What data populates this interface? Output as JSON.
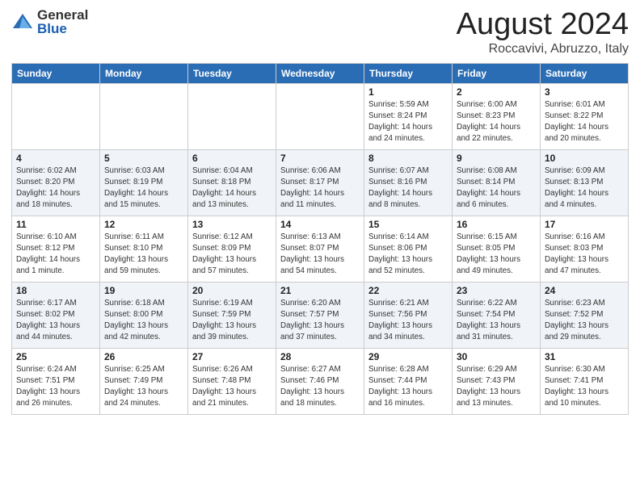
{
  "logo": {
    "general": "General",
    "blue": "Blue"
  },
  "title": "August 2024",
  "location": "Roccavivi, Abruzzo, Italy",
  "headers": [
    "Sunday",
    "Monday",
    "Tuesday",
    "Wednesday",
    "Thursday",
    "Friday",
    "Saturday"
  ],
  "weeks": [
    [
      {
        "day": "",
        "info": ""
      },
      {
        "day": "",
        "info": ""
      },
      {
        "day": "",
        "info": ""
      },
      {
        "day": "",
        "info": ""
      },
      {
        "day": "1",
        "info": "Sunrise: 5:59 AM\nSunset: 8:24 PM\nDaylight: 14 hours\nand 24 minutes."
      },
      {
        "day": "2",
        "info": "Sunrise: 6:00 AM\nSunset: 8:23 PM\nDaylight: 14 hours\nand 22 minutes."
      },
      {
        "day": "3",
        "info": "Sunrise: 6:01 AM\nSunset: 8:22 PM\nDaylight: 14 hours\nand 20 minutes."
      }
    ],
    [
      {
        "day": "4",
        "info": "Sunrise: 6:02 AM\nSunset: 8:20 PM\nDaylight: 14 hours\nand 18 minutes."
      },
      {
        "day": "5",
        "info": "Sunrise: 6:03 AM\nSunset: 8:19 PM\nDaylight: 14 hours\nand 15 minutes."
      },
      {
        "day": "6",
        "info": "Sunrise: 6:04 AM\nSunset: 8:18 PM\nDaylight: 14 hours\nand 13 minutes."
      },
      {
        "day": "7",
        "info": "Sunrise: 6:06 AM\nSunset: 8:17 PM\nDaylight: 14 hours\nand 11 minutes."
      },
      {
        "day": "8",
        "info": "Sunrise: 6:07 AM\nSunset: 8:16 PM\nDaylight: 14 hours\nand 8 minutes."
      },
      {
        "day": "9",
        "info": "Sunrise: 6:08 AM\nSunset: 8:14 PM\nDaylight: 14 hours\nand 6 minutes."
      },
      {
        "day": "10",
        "info": "Sunrise: 6:09 AM\nSunset: 8:13 PM\nDaylight: 14 hours\nand 4 minutes."
      }
    ],
    [
      {
        "day": "11",
        "info": "Sunrise: 6:10 AM\nSunset: 8:12 PM\nDaylight: 14 hours\nand 1 minute."
      },
      {
        "day": "12",
        "info": "Sunrise: 6:11 AM\nSunset: 8:10 PM\nDaylight: 13 hours\nand 59 minutes."
      },
      {
        "day": "13",
        "info": "Sunrise: 6:12 AM\nSunset: 8:09 PM\nDaylight: 13 hours\nand 57 minutes."
      },
      {
        "day": "14",
        "info": "Sunrise: 6:13 AM\nSunset: 8:07 PM\nDaylight: 13 hours\nand 54 minutes."
      },
      {
        "day": "15",
        "info": "Sunrise: 6:14 AM\nSunset: 8:06 PM\nDaylight: 13 hours\nand 52 minutes."
      },
      {
        "day": "16",
        "info": "Sunrise: 6:15 AM\nSunset: 8:05 PM\nDaylight: 13 hours\nand 49 minutes."
      },
      {
        "day": "17",
        "info": "Sunrise: 6:16 AM\nSunset: 8:03 PM\nDaylight: 13 hours\nand 47 minutes."
      }
    ],
    [
      {
        "day": "18",
        "info": "Sunrise: 6:17 AM\nSunset: 8:02 PM\nDaylight: 13 hours\nand 44 minutes."
      },
      {
        "day": "19",
        "info": "Sunrise: 6:18 AM\nSunset: 8:00 PM\nDaylight: 13 hours\nand 42 minutes."
      },
      {
        "day": "20",
        "info": "Sunrise: 6:19 AM\nSunset: 7:59 PM\nDaylight: 13 hours\nand 39 minutes."
      },
      {
        "day": "21",
        "info": "Sunrise: 6:20 AM\nSunset: 7:57 PM\nDaylight: 13 hours\nand 37 minutes."
      },
      {
        "day": "22",
        "info": "Sunrise: 6:21 AM\nSunset: 7:56 PM\nDaylight: 13 hours\nand 34 minutes."
      },
      {
        "day": "23",
        "info": "Sunrise: 6:22 AM\nSunset: 7:54 PM\nDaylight: 13 hours\nand 31 minutes."
      },
      {
        "day": "24",
        "info": "Sunrise: 6:23 AM\nSunset: 7:52 PM\nDaylight: 13 hours\nand 29 minutes."
      }
    ],
    [
      {
        "day": "25",
        "info": "Sunrise: 6:24 AM\nSunset: 7:51 PM\nDaylight: 13 hours\nand 26 minutes."
      },
      {
        "day": "26",
        "info": "Sunrise: 6:25 AM\nSunset: 7:49 PM\nDaylight: 13 hours\nand 24 minutes."
      },
      {
        "day": "27",
        "info": "Sunrise: 6:26 AM\nSunset: 7:48 PM\nDaylight: 13 hours\nand 21 minutes."
      },
      {
        "day": "28",
        "info": "Sunrise: 6:27 AM\nSunset: 7:46 PM\nDaylight: 13 hours\nand 18 minutes."
      },
      {
        "day": "29",
        "info": "Sunrise: 6:28 AM\nSunset: 7:44 PM\nDaylight: 13 hours\nand 16 minutes."
      },
      {
        "day": "30",
        "info": "Sunrise: 6:29 AM\nSunset: 7:43 PM\nDaylight: 13 hours\nand 13 minutes."
      },
      {
        "day": "31",
        "info": "Sunrise: 6:30 AM\nSunset: 7:41 PM\nDaylight: 13 hours\nand 10 minutes."
      }
    ]
  ]
}
